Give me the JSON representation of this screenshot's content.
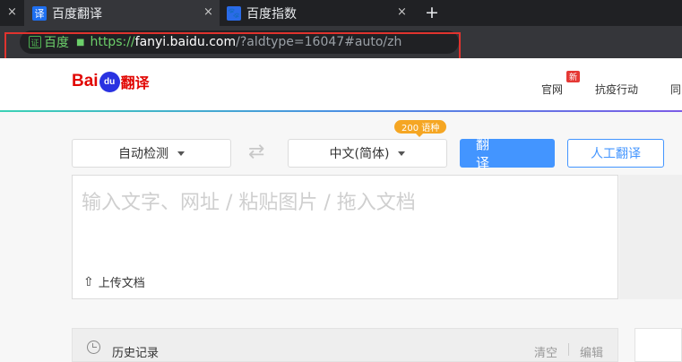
{
  "browser": {
    "tabs": [
      {
        "title": "百度翻译",
        "favicon": "译"
      },
      {
        "title": "百度指数",
        "favicon": "🐾"
      }
    ],
    "close_glyph": "×",
    "new_tab_glyph": "+"
  },
  "address_bar": {
    "cert_badge": "证",
    "cert_name": "百度",
    "scheme": "https://",
    "host": "fanyi.baidu.com",
    "path": "/?aldtype=16047#auto/zh"
  },
  "header": {
    "logo": {
      "bai": "Bai",
      "du": "du",
      "fanyi": "翻译"
    },
    "nav": {
      "official": "官网",
      "new_badge": "新",
      "covid": "抗疫行动",
      "more": "同"
    }
  },
  "controls": {
    "source_lang": "自动检测",
    "swap_icon": "⇄",
    "target_lang": "中文(简体)",
    "lang_count": "200 语种",
    "translate_button": "翻 译",
    "human_button": "人工翻译"
  },
  "input": {
    "placeholder": "输入文字、网址 / 粘贴图片 / 拖入文档",
    "upload_label": "上传文档",
    "upload_icon": "⇧"
  },
  "history": {
    "label": "历史记录",
    "clear": "清空",
    "edit": "编辑"
  },
  "colors": {
    "accent": "#4395ff",
    "logo_red": "#e10602",
    "logo_blue": "#2932e1",
    "badge_orange": "#f5a623",
    "highlight_red": "#e0332e"
  }
}
